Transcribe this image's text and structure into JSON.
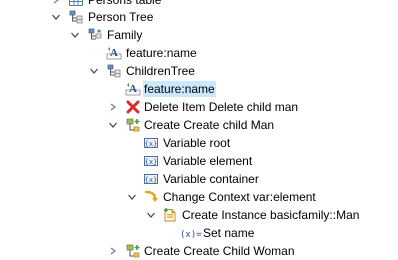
{
  "tree": {
    "persons_table_label": "Persons table",
    "person_tree_label": "Person Tree",
    "family_label": "Family",
    "family_feature_label": "feature:name",
    "children_tree_label": "ChildrenTree",
    "children_feature_label": "feature:name",
    "delete_item_label": "Delete Item Delete child man",
    "create_child_man_label": "Create Create child Man",
    "variable_root_label": "Variable root",
    "variable_element_label": "Variable element",
    "variable_container_label": "Variable container",
    "change_context_label": "Change Context var:element",
    "create_instance_label": "Create Instance basicfamily::Man",
    "set_name_label": "Set name",
    "create_child_woman_label": "Create Create Child Woman"
  },
  "colors": {
    "selection": "#cce8ff",
    "twisty": "#4d4d4d",
    "delete_red": "#d92b2b",
    "change_context_yellow": "#e8a317"
  }
}
